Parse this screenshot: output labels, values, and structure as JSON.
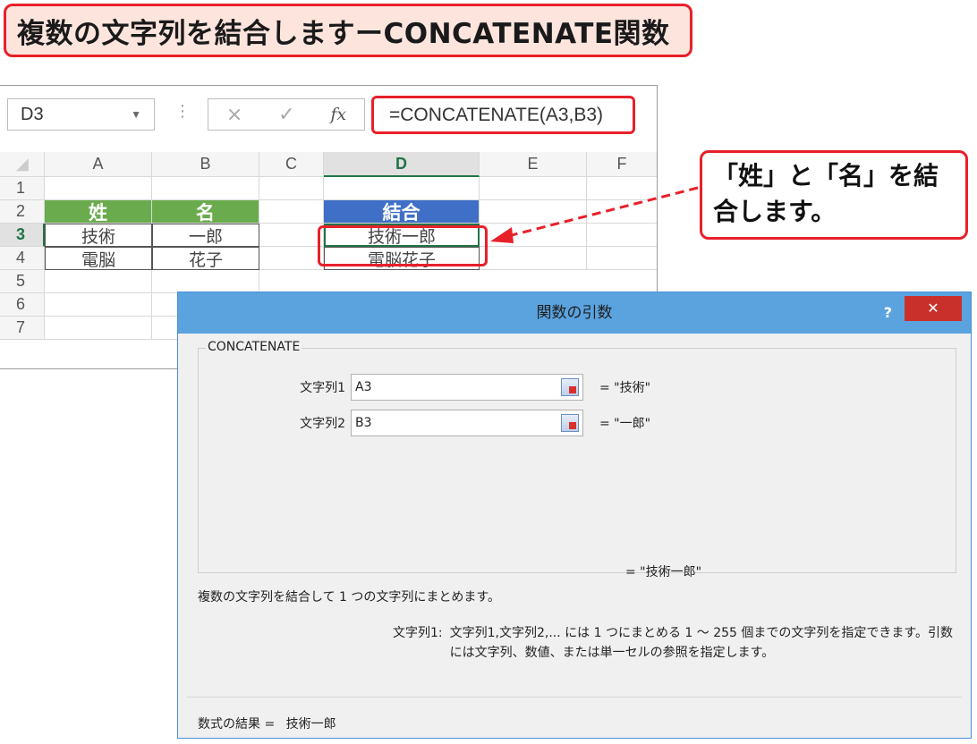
{
  "title": "複数の文字列を結合しますーCONCATENATE関数",
  "excel": {
    "name_box": "D3",
    "formula": "=CONCATENATE(A3,B3)",
    "columns": [
      "A",
      "B",
      "C",
      "D",
      "E",
      "F"
    ],
    "rows": [
      {
        "num": "1",
        "A": "",
        "B": "",
        "C": "",
        "D": ""
      },
      {
        "num": "2",
        "A": "姓",
        "B": "名",
        "C": "",
        "D": "結合"
      },
      {
        "num": "3",
        "A": "技術",
        "B": "一郎",
        "C": "",
        "D": "技術一郎"
      },
      {
        "num": "4",
        "A": "電脳",
        "B": "花子",
        "C": "",
        "D": "電脳花子"
      },
      {
        "num": "5"
      },
      {
        "num": "6"
      },
      {
        "num": "7"
      }
    ],
    "cancel_icon": "×",
    "enter_icon": "✓",
    "fx_icon": "fx"
  },
  "callout": "「姓」と「名」を結合します。",
  "dialog": {
    "title": "関数の引数",
    "help": "?",
    "close": "✕",
    "function_name": "CONCATENATE",
    "args": [
      {
        "label": "文字列1",
        "value": "A3",
        "result": "= \"技術\""
      },
      {
        "label": "文字列2",
        "value": "B3",
        "result": "= \"一郎\""
      }
    ],
    "result": "= \"技術一郎\"",
    "description": "複数の文字列を結合して 1 つの文字列にまとめます。",
    "arg_desc_key": "文字列1:",
    "arg_desc": "文字列1,文字列2,... には 1 つにまとめる 1 ～ 255 個までの文字列を指定できます。引数には文字列、数値、または単一セルの参照を指定します。",
    "formula_result_label": "数式の結果 =",
    "formula_result": "技術一郎"
  },
  "colors": {
    "accent_red": "#e8202a",
    "header_green": "#6aac4d",
    "header_blue": "#3f6fc6",
    "dialog_title": "#5aa3df"
  }
}
